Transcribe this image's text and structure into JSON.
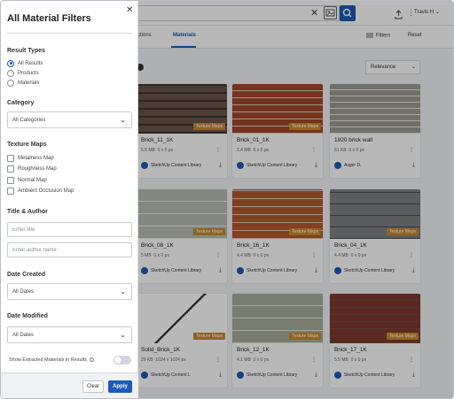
{
  "header": {
    "search_clear": "✕",
    "user_name": "Travis H",
    "user_chevron": "⌄"
  },
  "tabs": [
    {
      "label": "ctions"
    },
    {
      "label": "Materials",
      "active": true
    }
  ],
  "toolbar": {
    "filters_label": "Filters",
    "reset_label": "Reset",
    "sort_value": "Relevance"
  },
  "colors": {
    "accent": "#1c5bb8",
    "badge": "#c98a2d"
  },
  "cards": [
    {
      "title": "Brick_11_1K",
      "size": "5.6 MB",
      "dims": "0 x 0 px",
      "author": "SketchUp Content Library",
      "badge": "Texture Maps",
      "texture": "brick-dark"
    },
    {
      "title": "Brick_01_1K",
      "size": "2.4 MB",
      "dims": "0 x 0 px",
      "author": "SketchUp Content Library",
      "badge": "Texture Maps",
      "texture": "brick-red"
    },
    {
      "title": "1920 brick wall",
      "size": "61 KB",
      "dims": "0 x 0 px",
      "author": "Asger D.",
      "badge": "",
      "texture": "stone-grey"
    },
    {
      "title": "Brick_08_1K",
      "size": "5 MB",
      "dims": "0 x 0 px",
      "author": "SketchUp Content Library",
      "badge": "Texture Maps",
      "texture": "block-light"
    },
    {
      "title": "Brick_16_1K",
      "size": "4.4 MB",
      "dims": "0 x 0 px",
      "author": "SketchUp Content Library",
      "badge": "Texture Maps",
      "texture": "brick-orange"
    },
    {
      "title": "Brick_04_1K",
      "size": "4.4 MB",
      "dims": "0 x 0 px",
      "author": "SketchUp Content Library",
      "badge": "Texture Maps",
      "texture": "block-dark"
    },
    {
      "title": "Solid_Brick_1K",
      "size": "29 KB",
      "dims": "1024 x 1024 px",
      "author": "SketchUp Content L",
      "badge": "Texture Maps",
      "texture": "lines-white"
    },
    {
      "title": "Brick_12_1K",
      "size": "4.1 MB",
      "dims": "0 x 0 px",
      "author": "SketchUp Content Library",
      "badge": "Texture Maps",
      "texture": "block-sage"
    },
    {
      "title": "Brick_17_1K",
      "size": "5.5 MB",
      "dims": "0 x 0 px",
      "author": "SketchUp Content Library",
      "badge": "Texture Maps",
      "texture": "brick-brown"
    }
  ],
  "drawer": {
    "title": "All Material Filters",
    "close_glyph": "✕",
    "result_types": {
      "heading": "Result Types",
      "options": [
        "All Results",
        "Products",
        "Materials"
      ],
      "selected": "All Results"
    },
    "category": {
      "heading": "Category",
      "value": "All Categories"
    },
    "texture_maps": {
      "heading": "Texture Maps",
      "options": [
        "Metalness Map",
        "Roughness Map",
        "Normal Map",
        "Ambient Occlusion Map"
      ]
    },
    "title_author": {
      "heading": "Title & Author",
      "title_placeholder": "Enter title",
      "author_placeholder": "Enter author name"
    },
    "date_created": {
      "heading": "Date Created",
      "value": "All Dates"
    },
    "date_modified": {
      "heading": "Date Modified",
      "value": "All Dates"
    },
    "show_extracted": {
      "label": "Show Extracted Materials in Results",
      "enabled": false
    },
    "footer": {
      "clear_label": "Clear",
      "apply_label": "Apply"
    }
  }
}
